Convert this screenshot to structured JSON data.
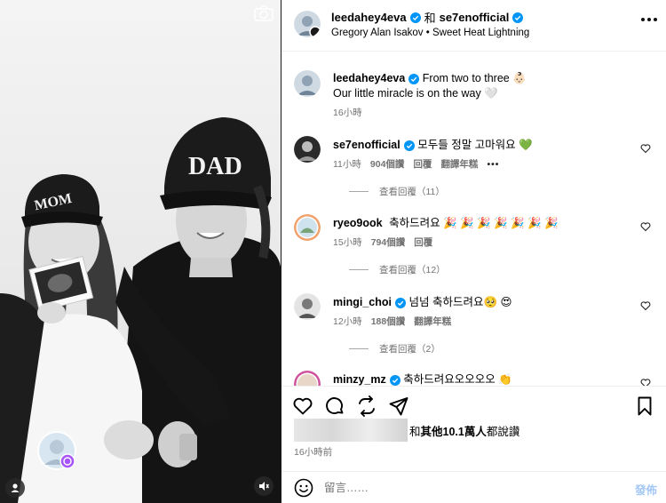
{
  "header": {
    "user1": "leedahey4eva",
    "conjunction": "和",
    "user2": "se7enofficial",
    "song": "Gregory Alan Isakov • Sweet Heat Lightning"
  },
  "caption": {
    "user": "leedahey4eva",
    "line1": "From two to three 👶🏻",
    "line2": "Our little miracle is on the way 🤍",
    "time": "16小時"
  },
  "comments": [
    {
      "user": "se7enofficial",
      "text": "모두들 정말 고마워요 💚",
      "time": "11小時",
      "likes": "904個讚",
      "reply": "回覆",
      "translate": "翻譯年糕",
      "more": "•••",
      "view_replies": "查看回覆（11）"
    },
    {
      "user": "ryeo9ook",
      "text": "축하드려요 🎉 🎉 🎉 🎉 🎉 🎉 🎉",
      "time": "15小時",
      "likes": "794個讚",
      "reply": "回覆",
      "view_replies": "查看回覆（12）"
    },
    {
      "user": "mingi_choi",
      "text": "넘넘 축하드려요🥺 😍",
      "time": "12小時",
      "likes": "188個讚",
      "reply": "回覆",
      "translate": "翻譯年糕",
      "view_replies": "查看回覆（2）"
    },
    {
      "user": "minzy_mz",
      "text": "축하드려요오오오오 👏"
    }
  ],
  "likes_summary": {
    "prefix": "和",
    "count": "其他10.1萬人",
    "suffix": "都說讚"
  },
  "time_ago": "16小時前",
  "composer": {
    "placeholder": "留言……",
    "post_label": "發佈"
  },
  "media": {
    "mom_cap_text": "MOM",
    "dad_cap_text": "DAD"
  },
  "colors": {
    "verified": "#0095f6",
    "post_disabled": "#a4c8f5",
    "meta_gray": "#737373"
  },
  "icons": [
    "camera-icon",
    "heart-icon",
    "comment-icon",
    "share-icon",
    "send-icon",
    "bookmark-icon",
    "emoji-icon",
    "more-icon",
    "mute-icon",
    "user-tag-icon"
  ]
}
